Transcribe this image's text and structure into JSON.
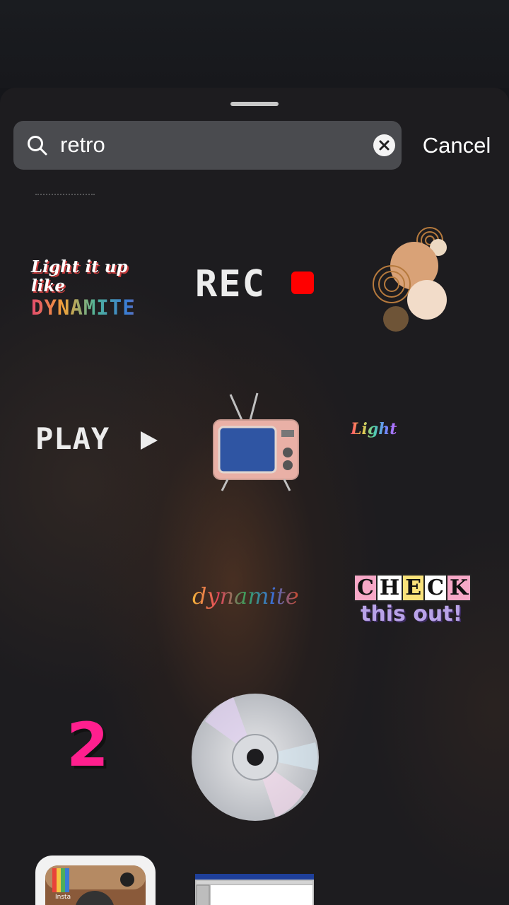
{
  "search": {
    "query": "retro",
    "cancel_label": "Cancel"
  },
  "stickers": {
    "dynamite": {
      "line1": "Light it up like",
      "line2": "DYNAMITE"
    },
    "rec": {
      "label": "REC"
    },
    "play": {
      "label": "PLAY"
    },
    "light": {
      "label": "Light"
    },
    "dynamite_script": {
      "label": "dynamite"
    },
    "check": {
      "letters": [
        "C",
        "H",
        "E",
        "C",
        "K"
      ],
      "sub": "this out!"
    },
    "number": {
      "label": "2"
    },
    "insta": {
      "label": "Insta"
    }
  },
  "colors": {
    "rec_dot": "#ff0000",
    "pink": "#ff1f8e",
    "search_bg": "#4a4b4f"
  }
}
